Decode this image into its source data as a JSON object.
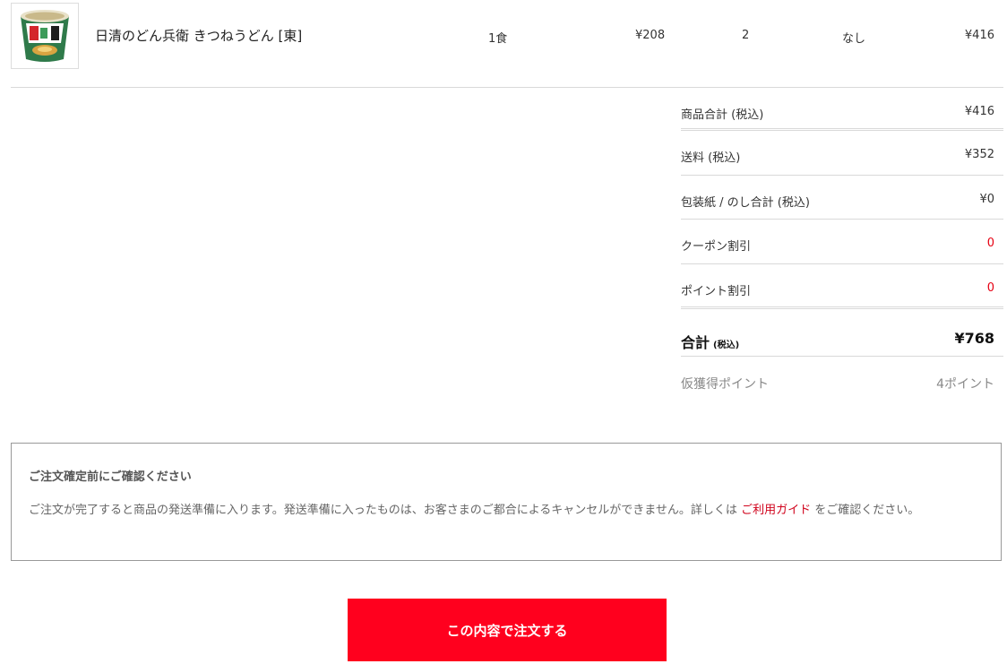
{
  "product": {
    "name": "日清のどん兵衛 きつねうどん [東]",
    "unit": "1食",
    "price": "¥208",
    "quantity": "2",
    "wrapping": "なし",
    "subtotal": "¥416",
    "thumbnail_icon": "cup-noodle-product-image"
  },
  "summary": {
    "items_total_label": "商品合計 (税込)",
    "items_total_value": "¥416",
    "shipping_label": "送料 (税込)",
    "shipping_value": "¥352",
    "wrapping_total_label": "包装紙 / のし合計 (税込)",
    "wrapping_total_value": "¥0",
    "coupon_label": "クーポン割引",
    "coupon_value": "0",
    "point_discount_label": "ポイント割引",
    "point_discount_value": "0",
    "total_label": "合計",
    "total_tax_note": "(税込)",
    "total_value": "¥768",
    "provisional_points_label": "仮獲得ポイント",
    "provisional_points_value": "4ポイント"
  },
  "notice": {
    "title": "ご注文確定前にご確認ください",
    "body_before_link": "ご注文が完了すると商品の発送準備に入ります。発送準備に入ったものは、お客さまのご都合によるキャンセルができません。詳しくは ",
    "link_text": "ご利用ガイド",
    "body_after_link": " をご確認ください。"
  },
  "order_button": {
    "label": "この内容で注文する"
  },
  "colors": {
    "accent_red": "#ff001e",
    "discount_red": "#e60012",
    "link_red": "#d0021b"
  }
}
